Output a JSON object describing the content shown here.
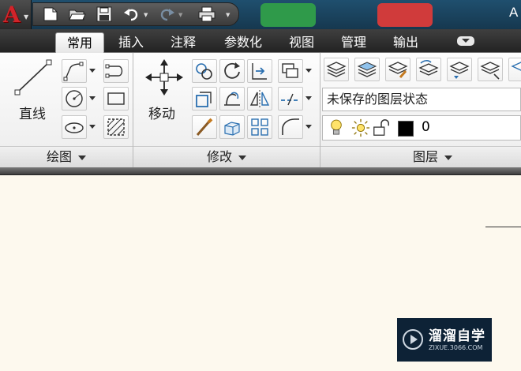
{
  "window": {
    "title_fragment": "A",
    "logo_letter": "A"
  },
  "tabs": [
    {
      "label": "常用",
      "active": true
    },
    {
      "label": "插入",
      "active": false
    },
    {
      "label": "注释",
      "active": false
    },
    {
      "label": "参数化",
      "active": false
    },
    {
      "label": "视图",
      "active": false
    },
    {
      "label": "管理",
      "active": false
    },
    {
      "label": "输出",
      "active": false
    }
  ],
  "panels": {
    "draw": {
      "title": "绘图",
      "line_label": "直线"
    },
    "modify": {
      "title": "修改",
      "move_label": "移动"
    },
    "layers": {
      "title": "图层",
      "layer_state": "未保存的图层状态",
      "current_layer": "0"
    }
  },
  "watermark": {
    "title": "溜溜自学",
    "url": "ZIXUE.3066.COM"
  },
  "colors": {
    "accent": "#d2242a",
    "layer_color": "#000000",
    "icon_blue": "#2a6fb0"
  }
}
